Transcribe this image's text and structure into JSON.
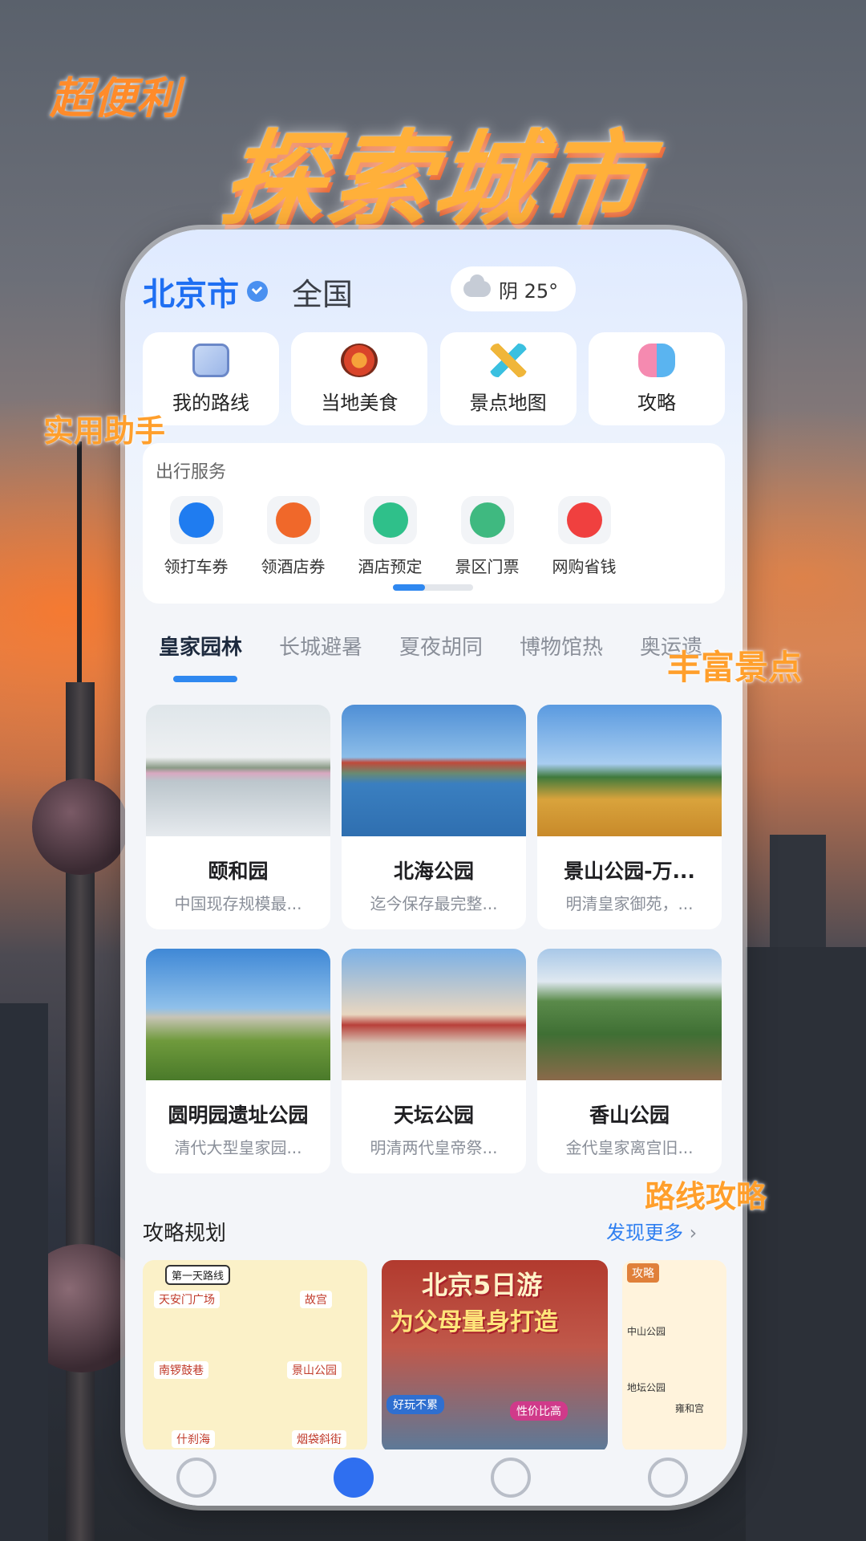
{
  "promo": {
    "headline": "探索城市",
    "badge_top": "超便利",
    "tag_helper": "实用助手",
    "tag_scenic": "丰富景点",
    "tag_route": "路线攻略"
  },
  "header": {
    "city": "北京市",
    "nation_tab": "全国",
    "weather": "阴 25°"
  },
  "quick_entries": [
    {
      "label": "我的路线",
      "icon": "map-route-icon"
    },
    {
      "label": "当地美食",
      "icon": "food-icon"
    },
    {
      "label": "景点地图",
      "icon": "windmill-icon"
    },
    {
      "label": "攻略",
      "icon": "smile-chat-icon"
    }
  ],
  "services": {
    "title": "出行服务",
    "items": [
      {
        "label": "领打车券",
        "color": "#1f7cf0",
        "icon": "car-icon"
      },
      {
        "label": "领酒店券",
        "color": "#f0682a",
        "icon": "hotel-coupon-icon"
      },
      {
        "label": "酒店预定",
        "color": "#2fc08a",
        "icon": "building-icon"
      },
      {
        "label": "景区门票",
        "color": "#3fb980",
        "icon": "ticket-icon"
      },
      {
        "label": "网购省钱",
        "color": "#f0403f",
        "icon": "shopping-bag-icon"
      }
    ]
  },
  "category_tabs": [
    "皇家园林",
    "长城避暑",
    "夏夜胡同",
    "博物馆热",
    "奥运遗"
  ],
  "attractions": [
    {
      "name": "颐和园",
      "desc": "中国现存规模最..."
    },
    {
      "name": "北海公园",
      "desc": "迄今保存最完整..."
    },
    {
      "name": "景山公园-万...",
      "desc": "明清皇家御苑，..."
    },
    {
      "name": "圆明园遗址公园",
      "desc": "清代大型皇家园..."
    },
    {
      "name": "天坛公园",
      "desc": "明清两代皇帝祭..."
    },
    {
      "name": "香山公园",
      "desc": "金代皇家离宫旧..."
    }
  ],
  "plans": {
    "title": "攻略规划",
    "more": "发现更多",
    "cards": [
      {
        "heading": "第一天路线",
        "stops": [
          "天安门广场",
          "故宫",
          "南锣鼓巷",
          "景山公园",
          "什刹海",
          "烟袋斜街"
        ]
      },
      {
        "heading": "北京5日游",
        "subheading": "为父母量身打造",
        "badges": [
          "好玩不累",
          "性价比高"
        ]
      },
      {
        "heading": "攻略",
        "stops": [
          "中山公园",
          "地坛公园",
          "雍和宫"
        ]
      }
    ]
  },
  "colors": {
    "accent": "#2f88f0",
    "promo": "#ff9f2c"
  }
}
